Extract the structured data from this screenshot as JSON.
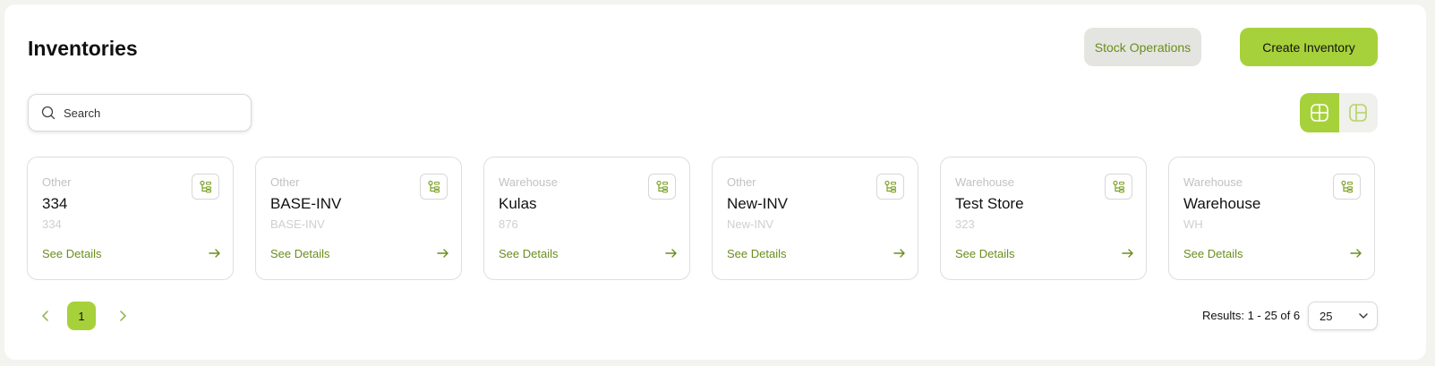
{
  "header": {
    "title": "Inventories",
    "stock_operations_label": "Stock Operations",
    "create_inventory_label": "Create Inventory"
  },
  "search": {
    "placeholder": "Search",
    "value": ""
  },
  "view_toggle": {
    "active": "grid"
  },
  "cards": [
    {
      "type": "Other",
      "name": "334",
      "code": "334",
      "link": "See Details"
    },
    {
      "type": "Other",
      "name": "BASE-INV",
      "code": "BASE-INV",
      "link": "See Details"
    },
    {
      "type": "Warehouse",
      "name": "Kulas",
      "code": "876",
      "link": "See Details"
    },
    {
      "type": "Other",
      "name": "New-INV",
      "code": "New-INV",
      "link": "See Details"
    },
    {
      "type": "Warehouse",
      "name": "Test Store",
      "code": "323",
      "link": "See Details"
    },
    {
      "type": "Warehouse",
      "name": "Warehouse",
      "code": "WH",
      "link": "See Details"
    }
  ],
  "pagination": {
    "current_page": "1",
    "results_text": "Results: 1 - 25 of 6",
    "page_size": "25"
  },
  "colors": {
    "accent": "#a7d13a",
    "accent_text": "#6a8d1c",
    "secondary_button": "#e4e5e0"
  }
}
